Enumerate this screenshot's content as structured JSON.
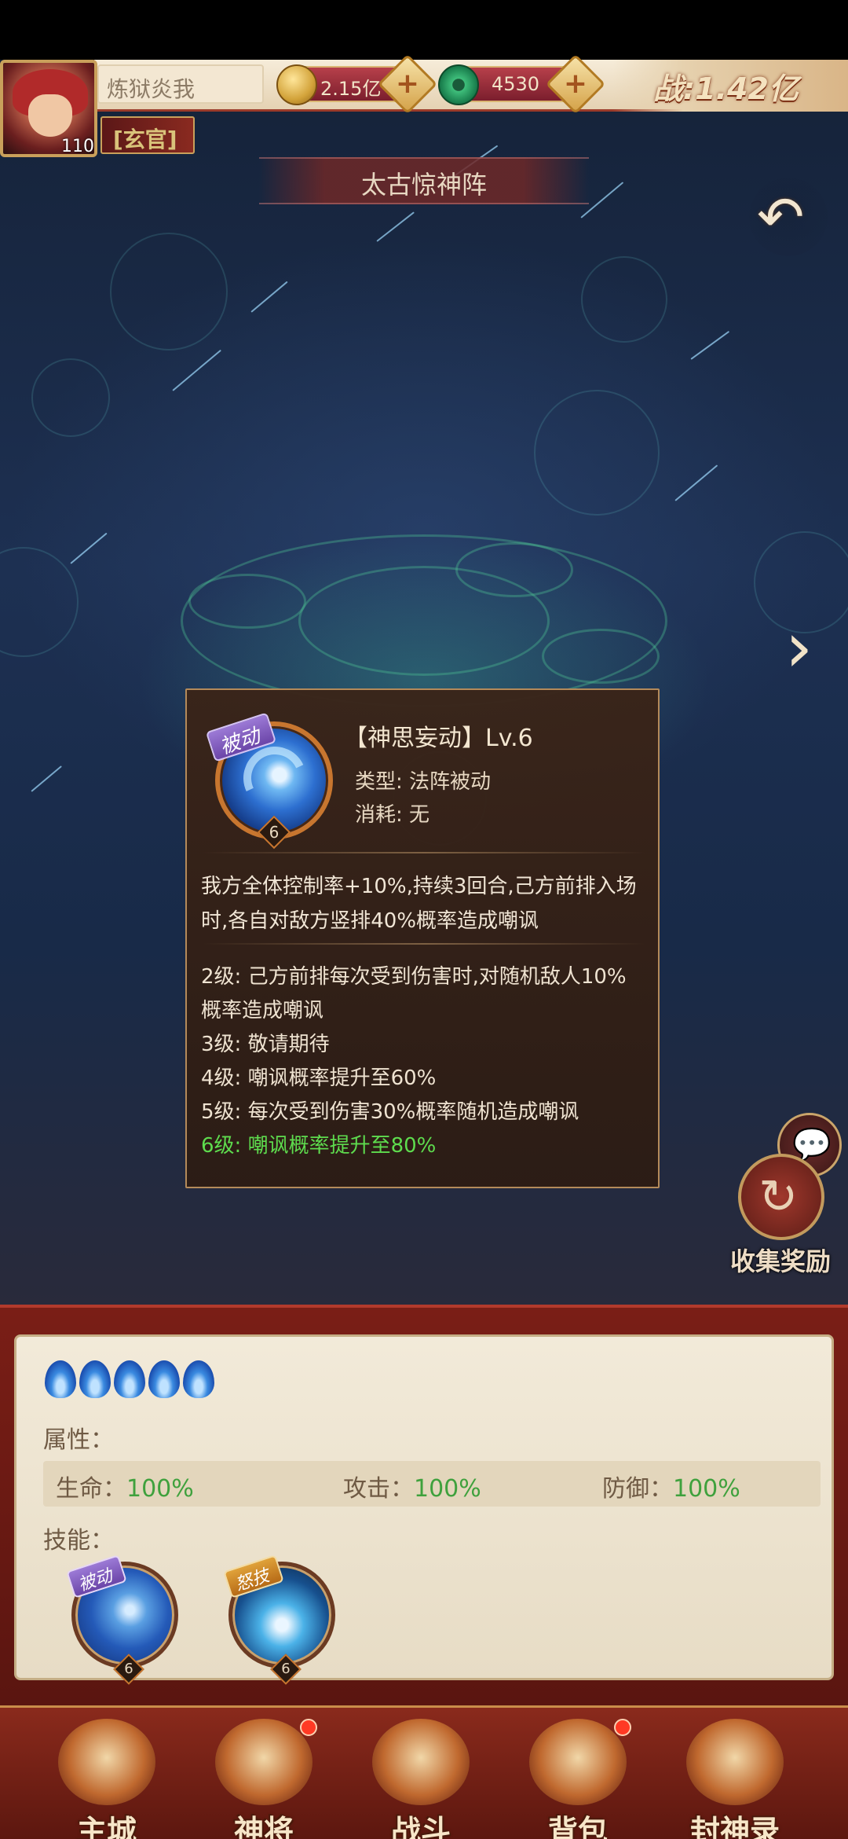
{
  "hud": {
    "player_name": "炼狱炎我",
    "level": "110",
    "rank": "[玄官]",
    "coins": "2.15亿",
    "jade": "4530",
    "plus": "+",
    "power": "战:1.42亿"
  },
  "page": {
    "title": "太古惊神阵",
    "back_icon": "↶",
    "next_icon": "›"
  },
  "popup": {
    "badge": "被动",
    "level_gem": "6",
    "skill_name": "【神思妄动】Lv.6",
    "type": "类型: 法阵被动",
    "cost": "消耗: 无",
    "description": "我方全体控制率+10%,持续3回合,己方前排入场时,各自对敌方竖排40%概率造成嘲讽",
    "levels": [
      "2级: 己方前排每次受到伤害时,对随机敌人10%概率造成嘲讽",
      "3级: 敬请期待",
      "4级: 嘲讽概率提升至60%",
      "5级: 每次受到伤害30%概率随机造成嘲讽",
      "6级: 嘲讽概率提升至80%"
    ],
    "active_level_index": 4,
    "active_color": "#5edc4e"
  },
  "side": {
    "chat_icon": "💬",
    "collect_icon": "↻",
    "collect_label": "收集奖励"
  },
  "panel": {
    "attr_label": "属性：",
    "attrs": [
      {
        "name": "生命：",
        "value": "100%"
      },
      {
        "name": "攻击：",
        "value": "100%"
      },
      {
        "name": "防御：",
        "value": "100%"
      }
    ],
    "skills_label": "技能：",
    "skills": [
      {
        "badge": "被动",
        "level": "6"
      },
      {
        "badge": "怒技",
        "level": "6"
      }
    ]
  },
  "nav": {
    "items": [
      "主城",
      "神将",
      "战斗",
      "背包",
      "封神录"
    ]
  },
  "colors": {
    "value_green": "#3fa13d",
    "popup_bg": "#3a2418",
    "accent_gold": "#c9a05b"
  }
}
